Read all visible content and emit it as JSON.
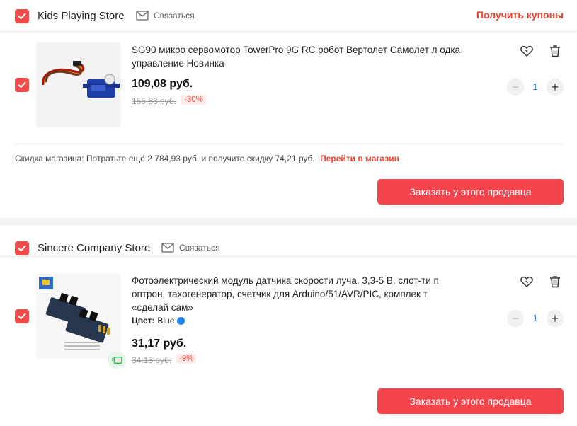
{
  "stores": [
    {
      "name": "Kids Playing Store",
      "contact_label": "Связаться",
      "coupons_label": "Получить купоны",
      "product": {
        "title": "SG90 микро сервомотор TowerPro 9G RC робот Вертолет Самолет л одка управление Новинка",
        "price": "109,08 руб.",
        "old_price": "155,83 руб.",
        "discount": "-30%",
        "quantity": "1"
      },
      "promo": {
        "label": "Скидка магазина:",
        "text": "Потратьте ещё 2 784,93 руб. и получите скидку 74,21 руб.",
        "link": "Перейти в магазин"
      },
      "order_label": "Заказать у этого продавца"
    },
    {
      "name": "Sincere Company Store",
      "contact_label": "Связаться",
      "product": {
        "title": "Фотоэлектрический модуль датчика скорости луча, 3,3-5 В, слот-ти п оптрон, тахогенератор, счетчик для Arduino/51/AVR/PIC, комплек т «сделай сам»",
        "attr_label": "Цвет:",
        "attr_value": "Blue",
        "price": "31,17 руб.",
        "old_price": "34,13 руб.",
        "discount": "-9%",
        "quantity": "1"
      },
      "order_label": "Заказать у этого продавца"
    }
  ],
  "icons": {
    "checkbox": "checkbox-checked-icon",
    "contact": "envelope-icon",
    "wishlist": "heart-icon",
    "delete": "trash-icon",
    "minus": "minus-icon",
    "plus": "plus-icon"
  },
  "colors": {
    "accent": "#f5444c",
    "link": "#ee4330",
    "quantity": "#1f6fd0",
    "color_blue": "#1f86f0"
  },
  "quantity_controls": {
    "minus": "−",
    "plus": "+"
  }
}
